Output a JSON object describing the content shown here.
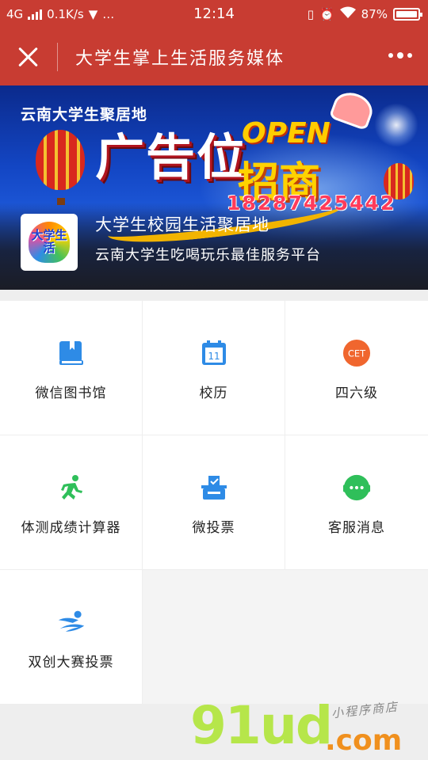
{
  "status_bar": {
    "network": "4G",
    "speed": "0.1K/s",
    "time": "12:14",
    "battery": "87%"
  },
  "title_bar": {
    "title": "大学生掌上生活服务媒体"
  },
  "banner": {
    "top_text": "云南大学生聚居地",
    "big_text": "广告位",
    "open_text": "OPEN",
    "zhaoshang_text": "招商",
    "phone": "18287425442",
    "logo_text": "大学生活",
    "mp_name": "大学生校园生活聚居地",
    "mp_desc": "云南大学生吃喝玩乐最佳服务平台"
  },
  "grid_items": [
    {
      "label": "微信图书馆",
      "icon": "book-icon",
      "color": "#2e8be6"
    },
    {
      "label": "校历",
      "icon": "calendar-icon",
      "color": "#2e8be6"
    },
    {
      "label": "四六级",
      "icon": "cet-icon",
      "icon_text": "CET",
      "color": "#f0662e"
    },
    {
      "label": "体测成绩计算器",
      "icon": "running-icon",
      "color": "#2fbf5a"
    },
    {
      "label": "微投票",
      "icon": "ballot-box-icon",
      "color": "#2e8be6"
    },
    {
      "label": "客服消息",
      "icon": "chat-bubble-icon",
      "color": "#2fbf5a"
    },
    {
      "label": "双创大赛投票",
      "icon": "swimmer-icon",
      "color": "#2e8be6"
    }
  ],
  "calendar_day": "11",
  "watermark": {
    "big": "91ud",
    "com": ".com",
    "small": "小程序商店"
  }
}
